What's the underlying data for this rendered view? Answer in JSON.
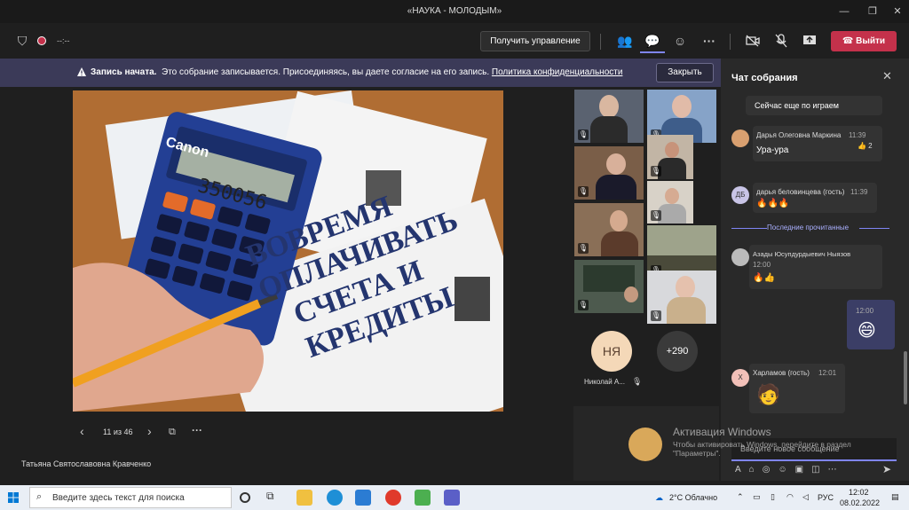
{
  "window": {
    "title": "«НАУКА - МОЛОДЫМ»"
  },
  "toolbar": {
    "timer": "--:--",
    "control_label": "Получить управление",
    "leave_label": "Выйти"
  },
  "banner": {
    "title": "Запись начата.",
    "text": "Это собрание записывается. Присоединяясь, вы даете согласие на его запись.",
    "link": "Политика конфиденциальности",
    "close_label": "Закрыть"
  },
  "slide": {
    "calc_brand": "Canon",
    "calc_display": "350056",
    "text_lines": [
      "ВОВРЕМЯ",
      "ОПЛАЧИВАТЬ",
      "СЧЕТА И",
      "КРЕДИТЫ"
    ],
    "nav_text": "11 из 46"
  },
  "presenter": {
    "name": "Татьяна Святославовна Кравченко"
  },
  "participants": {
    "avatar_initials": "НЯ",
    "avatar_name": "Николай А...",
    "more_count": "+290"
  },
  "chat": {
    "title": "Чат собрания",
    "messages": [
      {
        "body": "Сейчас еще по играем"
      },
      {
        "initials": "",
        "name": "Дарья Олеговна Маркина",
        "time": "11:39",
        "body": "Ура-ура",
        "reaction": "👍 2"
      },
      {
        "initials": "ДБ",
        "name": "дарья беловинцева (гость)",
        "time": "11:39",
        "body": "🔥🔥🔥"
      },
      {
        "initials": "",
        "name": "Азады Юсупдурдыевич Ныязов",
        "time": "12:00",
        "body": "🔥👍"
      },
      {
        "time": "12:00",
        "body": "😄"
      },
      {
        "initials": "Х",
        "name": "Харламов (гость)",
        "time": "12:01",
        "body": "🧑"
      }
    ],
    "last_read_label": "Последние прочитанные",
    "compose_placeholder": "Введите новое сообщение"
  },
  "activation": {
    "title": "Активация Windows",
    "line1": "Чтобы активировать Windows, перейдите в раздел",
    "line2": "\"Параметры\"."
  },
  "taskbar": {
    "search_placeholder": "Введите здесь текст для поиска",
    "weather": "2°C Облачно",
    "lang": "РУС",
    "time": "12:02",
    "date": "08.02.2022"
  },
  "colors": {
    "accent": "#6264a7",
    "leave": "#c4314b",
    "banner": "#3b3a58"
  }
}
